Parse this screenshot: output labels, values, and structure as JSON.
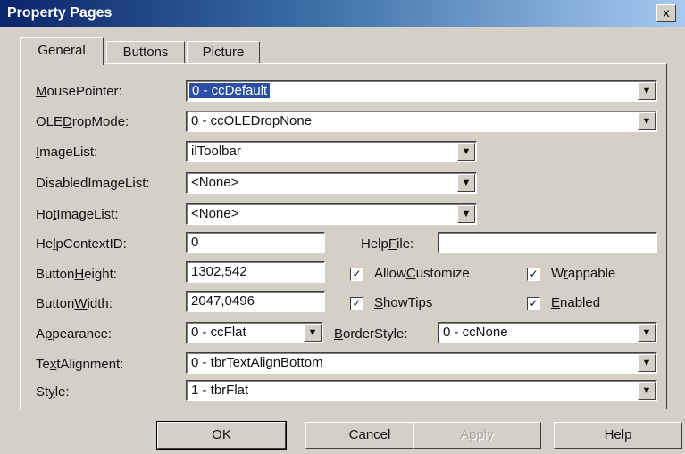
{
  "window": {
    "title": "Property Pages",
    "close_label": "x"
  },
  "tabs": [
    {
      "label": "General",
      "active": true
    },
    {
      "label": "Buttons",
      "active": false
    },
    {
      "label": "Picture",
      "active": false
    }
  ],
  "fields": {
    "mouse_pointer": {
      "label": "MousePointer:",
      "value": "0 - ccDefault"
    },
    "ole_drop_mode": {
      "label": "OLEDropMode:",
      "value": "0 - ccOLEDropNone"
    },
    "image_list": {
      "label": "ImageList:",
      "value": "ilToolbar"
    },
    "disabled_image_list": {
      "label": "DisabledImageList:",
      "value": "<None>"
    },
    "hot_image_list": {
      "label": "HotImageList:",
      "value": "<None>"
    },
    "help_context_id": {
      "label": "HelpContextID:",
      "value": "0"
    },
    "help_file": {
      "label": "HelpFile:",
      "value": ""
    },
    "button_height": {
      "label": "ButtonHeight:",
      "value": "1302,542"
    },
    "button_width": {
      "label": "ButtonWidth:",
      "value": "2047,0496"
    },
    "appearance": {
      "label": "Appearance:",
      "value": "0 - ccFlat"
    },
    "border_style": {
      "label": "BorderStyle:",
      "value": "0 - ccNone"
    },
    "text_alignment": {
      "label": "TextAlignment:",
      "value": "0 - tbrTextAlignBottom"
    },
    "style": {
      "label": "Style:",
      "value": "1 - tbrFlat"
    }
  },
  "checkboxes": {
    "allow_customize": {
      "label": "AllowCustomize",
      "checked": true
    },
    "wrappable": {
      "label": "Wrappable",
      "checked": true
    },
    "show_tips": {
      "label": "ShowTips",
      "checked": true
    },
    "enabled": {
      "label": "Enabled",
      "checked": true
    }
  },
  "buttons": {
    "ok": "OK",
    "cancel": "Cancel",
    "apply": "Apply",
    "help": "Help"
  },
  "icons": {
    "dropdown": "chevron-down-icon",
    "check": "checkmark-icon"
  }
}
